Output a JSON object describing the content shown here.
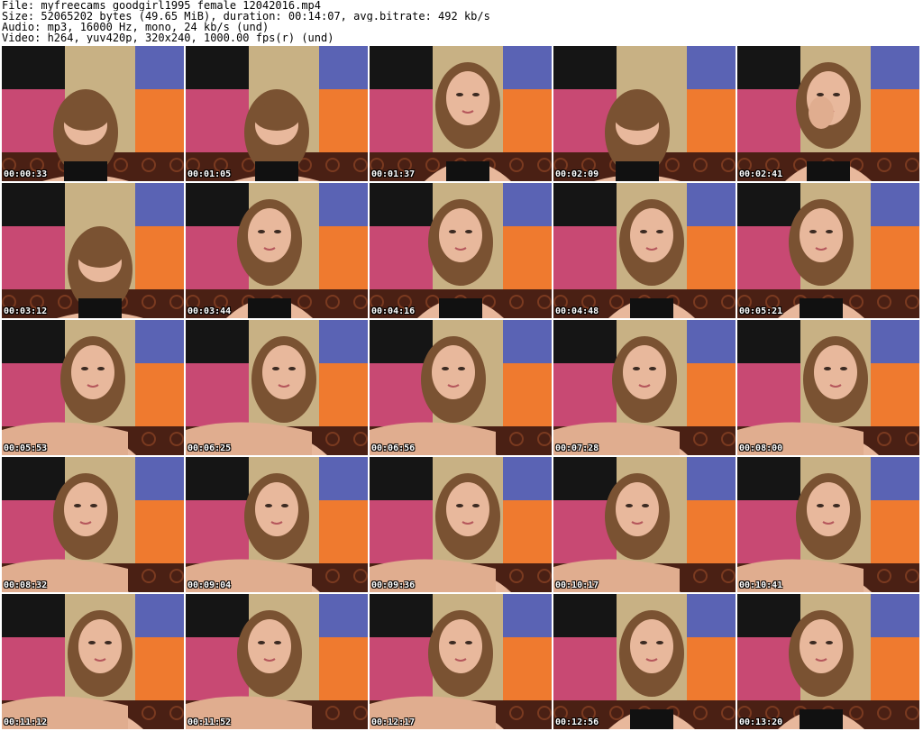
{
  "header": {
    "file_line": "File: myfreecams_goodgirl1995_female_12042016.mp4",
    "size_line": "Size: 52065202 bytes (49.65 MiB), duration: 00:14:07, avg.bitrate: 492 kb/s",
    "audio_line": "Audio: mp3, 16000 Hz, mono, 24 kb/s (und)",
    "video_line": "Video: h264, yuv420p, 320x240, 1000.00 fps(r) (und)"
  },
  "palette": {
    "dark": "#151515",
    "khaki": "#c8b184",
    "blue": "#5a63b4",
    "pink": "#c84973",
    "orange": "#ef7a2f",
    "sofa": "#4a2014",
    "hair": "#7a5232",
    "skin": "#e8b89c",
    "clothing": "#111111",
    "timestamp_text": "#ffffff"
  },
  "thumbnails": [
    {
      "time": "00:00:33",
      "head": "down",
      "arm": "none"
    },
    {
      "time": "00:01:05",
      "head": "down",
      "arm": "none"
    },
    {
      "time": "00:01:37",
      "head": "up",
      "arm": "none"
    },
    {
      "time": "00:02:09",
      "head": "down",
      "arm": "none"
    },
    {
      "time": "00:02:41",
      "head": "up",
      "arm": "face"
    },
    {
      "time": "00:03:12",
      "head": "down",
      "arm": "none"
    },
    {
      "time": "00:03:44",
      "head": "up",
      "arm": "none"
    },
    {
      "time": "00:04:16",
      "head": "up",
      "arm": "none"
    },
    {
      "time": "00:04:48",
      "head": "up",
      "arm": "none"
    },
    {
      "time": "00:05:21",
      "head": "up",
      "arm": "none"
    },
    {
      "time": "00:05:53",
      "head": "up",
      "arm": "front"
    },
    {
      "time": "00:06:25",
      "head": "up",
      "arm": "front"
    },
    {
      "time": "00:06:56",
      "head": "up",
      "arm": "front"
    },
    {
      "time": "00:07:28",
      "head": "up",
      "arm": "front"
    },
    {
      "time": "00:08:00",
      "head": "up",
      "arm": "front"
    },
    {
      "time": "00:08:32",
      "head": "up",
      "arm": "front"
    },
    {
      "time": "00:09:04",
      "head": "up",
      "arm": "front"
    },
    {
      "time": "00:09:36",
      "head": "up",
      "arm": "front"
    },
    {
      "time": "00:10:17",
      "head": "up",
      "arm": "front"
    },
    {
      "time": "00:10:41",
      "head": "up",
      "arm": "front"
    },
    {
      "time": "00:11:12",
      "head": "up",
      "arm": "front"
    },
    {
      "time": "00:11:52",
      "head": "up",
      "arm": "front"
    },
    {
      "time": "00:12:17",
      "head": "up",
      "arm": "front"
    },
    {
      "time": "00:12:56",
      "head": "up",
      "arm": "none"
    },
    {
      "time": "00:13:20",
      "head": "up",
      "arm": "none"
    }
  ]
}
